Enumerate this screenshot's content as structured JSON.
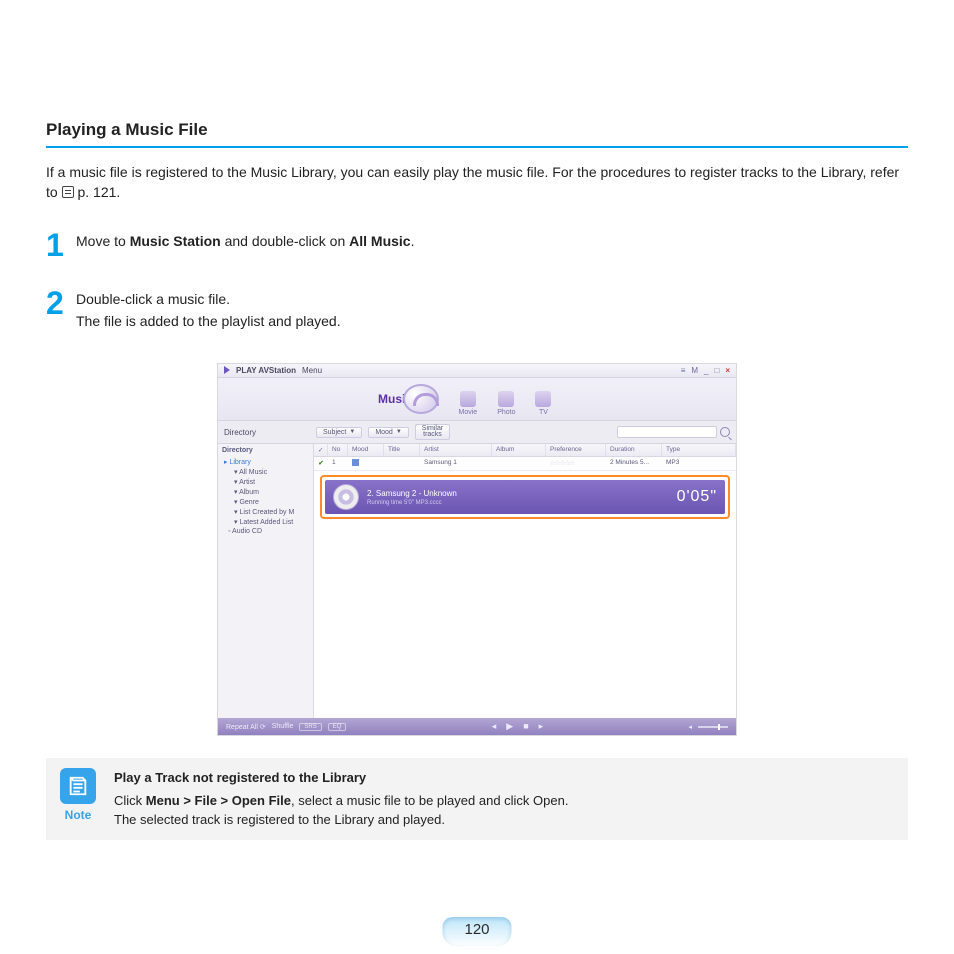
{
  "section_title": "Playing a Music File",
  "intro_before_icon": "If a music file is registered to the Music Library, you can easily play the music file. For the procedures to register tracks to the Library, refer to ",
  "intro_page_ref": " p. 121.",
  "steps": [
    {
      "num": "1",
      "body_html": "Move to <b>Music Station</b> and double-click on <b>All Music</b>."
    },
    {
      "num": "2",
      "body_html": "Double-click a music file.<br>The file is added to the playlist and played."
    }
  ],
  "app": {
    "title_prefix": "PLAY AVStation",
    "title_menu": "Menu",
    "win_ctrls": {
      "a": "≡",
      "b": "M",
      "c": "_",
      "d": "□",
      "e": "×"
    },
    "tabs": {
      "active_label": "Music",
      "others": [
        "Movie",
        "Photo",
        "TV"
      ]
    },
    "toolbar": {
      "directory": "Directory",
      "subject": "Subject",
      "mood": "Mood",
      "similar": "Similar\ntracks"
    },
    "sidebar": {
      "header": "Library",
      "items": [
        "All Music",
        "Artist",
        "Album",
        "Genre",
        "List Created by M",
        "Latest Added List"
      ],
      "audio_cd": "Audio CD"
    },
    "columns": {
      "chk": "✓",
      "no": "No",
      "mood": "Mood",
      "title": "Title",
      "artist": "Artist",
      "album": "Album",
      "pref": "Preference",
      "dur": "Duration",
      "type": "Type"
    },
    "row1": {
      "no": "1",
      "artist": "Samsung 1",
      "pref": "☆☆☆☆☆",
      "dur": "2 Minutes 5...",
      "type": "MP3"
    },
    "now_playing": {
      "title": "2. Samsung 2 - Unknown",
      "sub": "Running time 5'0\"        MP3.cccc",
      "time": "0'05\""
    },
    "footer": {
      "repeat": "Repeat All",
      "shuffle": "Shuffle",
      "srs": "SRS",
      "eq": "EQ"
    }
  },
  "note": {
    "label": "Note",
    "title": "Play a Track not registered to the Library",
    "line1_html": "Click <b>Menu > File > Open File</b>, select a music file to be played and click Open.",
    "line2": "The selected track is registered to the Library and played."
  },
  "page_number": "120"
}
